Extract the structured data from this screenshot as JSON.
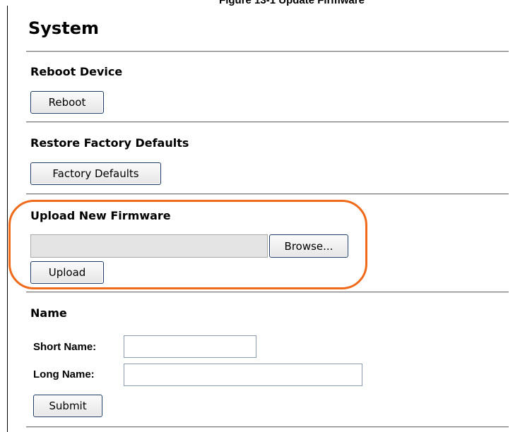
{
  "figure_caption": "Figure 13-1  Update Firmware",
  "page_title": "System",
  "reboot": {
    "heading": "Reboot Device",
    "button_label": "Reboot"
  },
  "factory": {
    "heading": "Restore Factory Defaults",
    "button_label": "Factory Defaults"
  },
  "firmware": {
    "heading": "Upload New Firmware",
    "file_value": "",
    "browse_label": "Browse...",
    "upload_label": "Upload"
  },
  "name": {
    "heading": "Name",
    "short_label": "Short Name:",
    "short_value": "",
    "long_label": "Long Name:",
    "long_value": "",
    "submit_label": "Submit"
  },
  "colors": {
    "highlight": "#f06a1a",
    "button_border": "#1c3a63"
  }
}
